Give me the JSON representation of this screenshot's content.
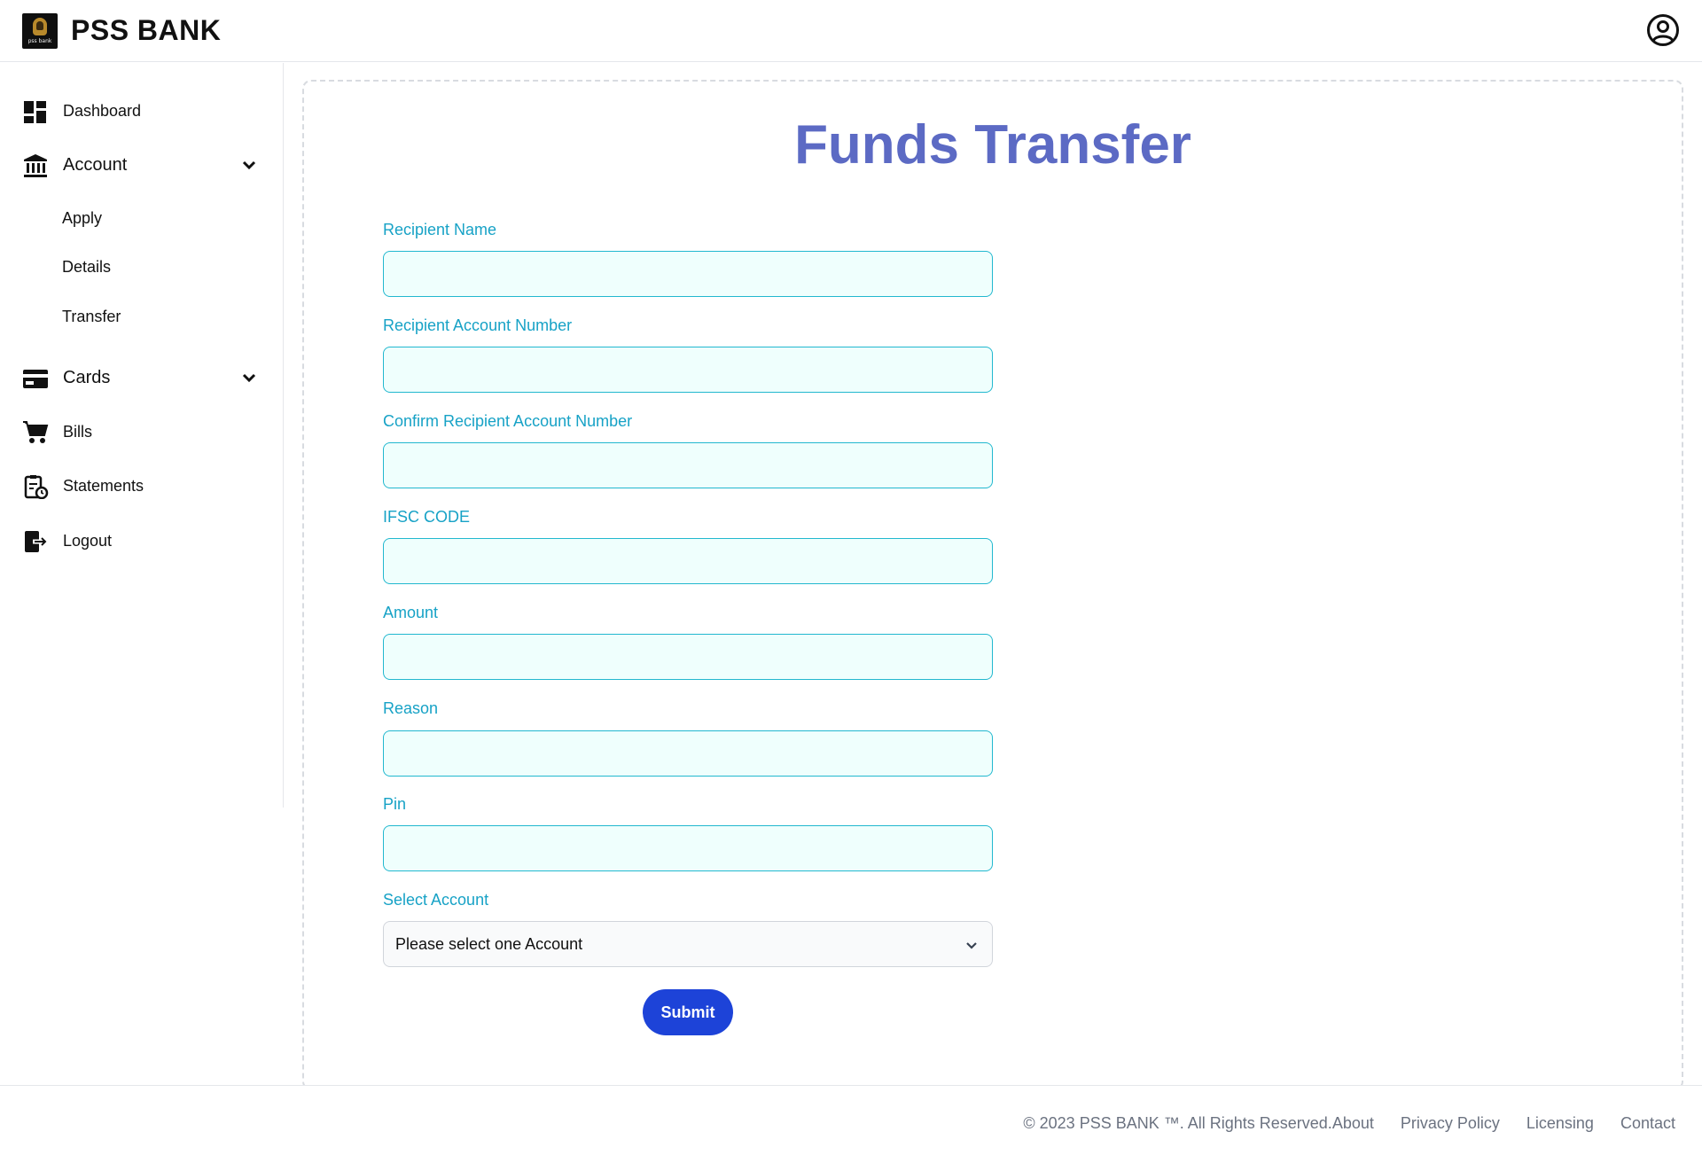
{
  "header": {
    "logo_text": "pss bank",
    "brand": "PSS BANK",
    "user_icon": "user-circle-icon"
  },
  "sidebar": {
    "dashboard": {
      "label": "Dashboard",
      "icon": "dashboard-icon"
    },
    "account": {
      "label": "Account",
      "icon": "bank-icon",
      "sub_items": [
        "Apply",
        "Details",
        "Transfer"
      ]
    },
    "cards": {
      "label": "Cards",
      "icon": "credit-card-icon"
    },
    "bills": {
      "label": "Bills",
      "icon": "cart-icon"
    },
    "statements": {
      "label": "Statements",
      "icon": "clipboard-clock-icon"
    },
    "logout": {
      "label": "Logout",
      "icon": "logout-icon"
    }
  },
  "main": {
    "title": "Funds Transfer",
    "fields": {
      "recipient_name": {
        "label": "Recipient Name",
        "value": ""
      },
      "recipient_account": {
        "label": "Recipient Account Number",
        "value": ""
      },
      "confirm_account": {
        "label": "Confirm Recipient Account Number",
        "value": ""
      },
      "ifsc": {
        "label": "IFSC CODE",
        "value": ""
      },
      "amount": {
        "label": "Amount",
        "value": ""
      },
      "reason": {
        "label": "Reason",
        "value": ""
      },
      "pin": {
        "label": "Pin",
        "value": ""
      }
    },
    "select_account": {
      "label": "Select Account",
      "selected": "Please select one Account"
    },
    "submit_label": "Submit"
  },
  "footer": {
    "copyright": "© 2023 PSS BANK ™. All Rights Reserved.",
    "links": [
      "About",
      "Privacy Policy",
      "Licensing",
      "Contact"
    ]
  },
  "colors": {
    "title": "#5c6ac4",
    "label": "#17a2c6",
    "input_bg": "#effffd",
    "input_border": "#22b8cf",
    "submit_bg": "#1d43d8"
  }
}
